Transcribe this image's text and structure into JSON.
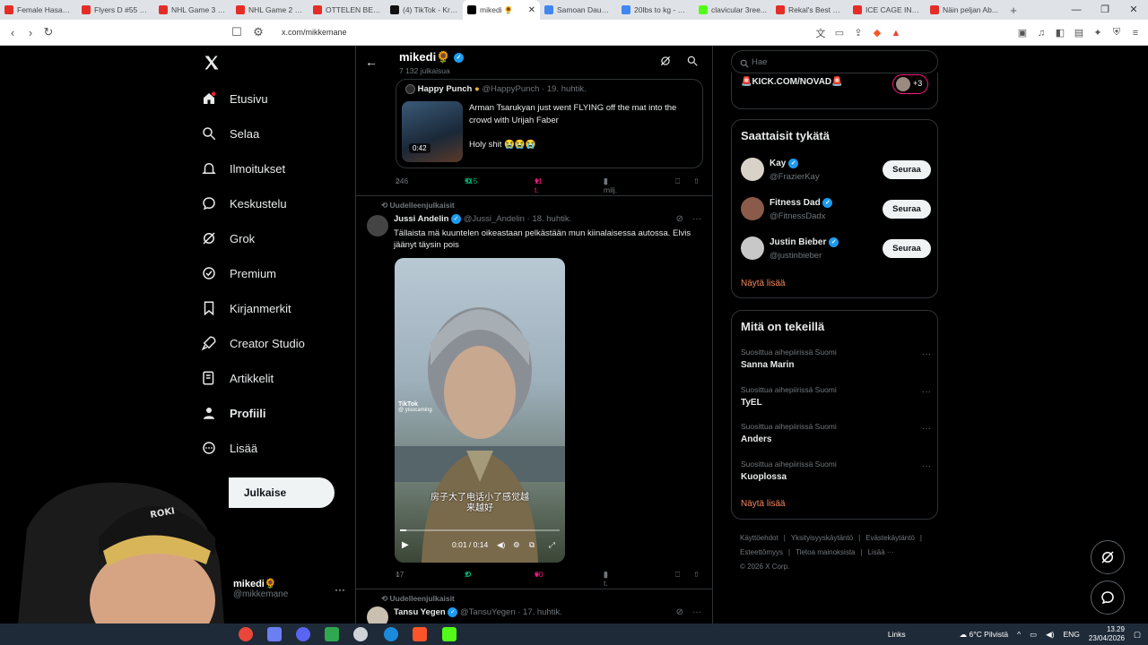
{
  "browser": {
    "tabs": [
      {
        "label": "Female Hasan...",
        "color": "#e52d27"
      },
      {
        "label": "Flyers D #55 Ka...",
        "color": "#e52d27"
      },
      {
        "label": "NHL Game 3 H...",
        "color": "#e52d27"
      },
      {
        "label": "NHL Game 2 H...",
        "color": "#e52d27"
      },
      {
        "label": "OTTELEN BEA...",
        "color": "#e52d27"
      },
      {
        "label": "(4) TikTok - Kru...",
        "color": "#111111"
      },
      {
        "label": "mikedi 🌻",
        "color": "#000000",
        "active": true
      },
      {
        "label": "Samoan Dauds...",
        "color": "#4285f4"
      },
      {
        "label": "20lbs to kg - G...",
        "color": "#4285f4"
      },
      {
        "label": "clavicular 3ree...",
        "color": "#53fc18"
      },
      {
        "label": "Rekal's Best Cli...",
        "color": "#e52d27"
      },
      {
        "label": "ICE CAGE INSIC...",
        "color": "#e52d27"
      },
      {
        "label": "Näin peljan Ab...",
        "color": "#e52d27"
      }
    ],
    "new_tab": "+",
    "url": "x.com/mikkemane"
  },
  "leftnav": {
    "items": [
      {
        "label": "Etusivu",
        "icon": "home-icon"
      },
      {
        "label": "Selaa",
        "icon": "search-icon"
      },
      {
        "label": "Ilmoitukset",
        "icon": "bell-icon"
      },
      {
        "label": "Keskustelu",
        "icon": "chat-icon"
      },
      {
        "label": "Grok",
        "icon": "grok-icon"
      },
      {
        "label": "Premium",
        "icon": "premium-icon"
      },
      {
        "label": "Kirjanmerkit",
        "icon": "bookmark-icon"
      },
      {
        "label": "Creator Studio",
        "icon": "rocket-icon"
      },
      {
        "label": "Artikkelit",
        "icon": "article-icon"
      },
      {
        "label": "Profiili",
        "icon": "profile-icon"
      },
      {
        "label": "Lisää",
        "icon": "more-circle-icon"
      }
    ],
    "post_button": "Julkaise",
    "profile": {
      "name": "mikedi🌻",
      "handle": "@mikkemane",
      "more": "···"
    }
  },
  "main": {
    "header": {
      "name": "mikedi🌻",
      "post_count": "7 132 julkaisua"
    },
    "quote": {
      "author": "Happy Punch",
      "handle": "@HappyPunch",
      "date": "· 19. huhtik.",
      "text1": "Arman Tsarukyan just went FLYING off the mat into the crowd with Urijah Faber",
      "text2": "Holy shit 😭😭😭",
      "duration": "0:42"
    },
    "post1_actions": {
      "replies": "246",
      "reposts": "515",
      "likes": "11 t.",
      "views": "2 milj."
    },
    "post2": {
      "repost_label": "Uudelleenjulkaisit",
      "author": "Jussi Andelin",
      "handle": "@Jussi_Andelin",
      "date": "· 18. huhtik.",
      "text": "Tällaista mä kuuntelen oikeastaan pelkästään mun kiinalaisessa autossa. Elvis jäänyt täysin pois",
      "video": {
        "watermark": "TikTok",
        "watermark_user": "@ yisocaming",
        "subtitle_line1": "房子大了电话小了感觉越",
        "subtitle_line2": "来越好",
        "time": "0:01 / 0:14",
        "progress": 0.04
      },
      "actions": {
        "replies": "17",
        "reposts": "2",
        "likes": "60",
        "views": "3 t."
      }
    },
    "post3": {
      "repost_label": "Uudelleenjulkaisit",
      "author": "Tansu Yegen",
      "handle": "@TansuYegen",
      "date": "· 17. huhtik."
    }
  },
  "right": {
    "search_placeholder": "Hae",
    "kick": {
      "text": "🚨KICK.COM/NOVAD🚨",
      "badge": "+3"
    },
    "who_to_follow": {
      "title": "Saattaisit tykätä",
      "people": [
        {
          "name": "Kay",
          "handle": "@FrazierKay",
          "button": "Seuraa"
        },
        {
          "name": "Fitness Dad",
          "handle": "@FitnessDadx",
          "button": "Seuraa"
        },
        {
          "name": "Justin Bieber",
          "handle": "@justinbieber",
          "button": "Seuraa"
        }
      ],
      "show_more": "Näytä lisää"
    },
    "trends": {
      "title": "Mitä on tekeillä",
      "items": [
        {
          "meta": "Suosittua aihepiirissä Suomi",
          "name": "Sanna Marin"
        },
        {
          "meta": "Suosittua aihepiirissä Suomi",
          "name": "TyEL"
        },
        {
          "meta": "Suosittua aihepiirissä Suomi",
          "name": "Anders"
        },
        {
          "meta": "Suosittua aihepiirissä Suomi",
          "name": "Kuoplossa"
        }
      ],
      "show_more": "Näytä lisää"
    },
    "footer": [
      "Käyttöehdot",
      "|",
      "Yksityisyyskäytäntö",
      "|",
      "Evästekäytäntö",
      "|",
      "Esteettömyys",
      "|",
      "Tietoa mainoksista",
      "|",
      "Lisää ···",
      "© 2026 X Corp."
    ]
  },
  "taskbar": {
    "links": "Links",
    "weather": "6°C  Pilvistä",
    "lang": "ENG",
    "time": "13.29",
    "date": "23/04/2026"
  },
  "colors": {
    "accent": "#1d9bf0",
    "like": "#f91880",
    "repost": "#00ba7c",
    "show_more": "#f4865b"
  }
}
